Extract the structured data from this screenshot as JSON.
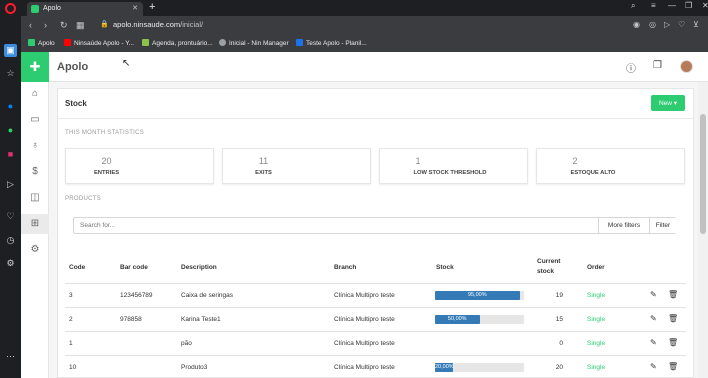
{
  "browser": {
    "tab_title": "Apolo",
    "url_host": "apolo.ninsaude.com",
    "url_path": "/inicial/",
    "bookmarks": [
      {
        "label": "Apolo",
        "color": "#2ecc71"
      },
      {
        "label": "Ninsaúde Apolo - Y...",
        "color": "#ff0000"
      },
      {
        "label": "Agenda, prontuário...",
        "color": "#8bc34a"
      },
      {
        "label": "Inicial - Nin Manager",
        "color": "#9aa0a6"
      },
      {
        "label": "Teste Apolo - Planil...",
        "color": "#1a73e8"
      }
    ]
  },
  "app": {
    "name": "Apolo",
    "brand_color": "#2ecc71"
  },
  "page": {
    "title": "Stock",
    "new_label": "New ▾",
    "stats_label": "THIS MONTH STATISTICS",
    "stats": [
      {
        "value": "20",
        "label": "ENTRIES"
      },
      {
        "value": "11",
        "label": "EXITS"
      },
      {
        "value": "1",
        "label": "LOW STOCK THRESHOLD"
      },
      {
        "value": "2",
        "label": "ESTOQUE ALTO"
      }
    ],
    "products_label": "PRODUCTS",
    "search": {
      "placeholder": "Search for...",
      "more_filters": "More filters",
      "filter": "Filter"
    },
    "columns": {
      "code": "Code",
      "barcode": "Bar code",
      "description": "Description",
      "branch": "Branch",
      "stock": "Stock",
      "current_stock_1": "Current",
      "current_stock_2": "stock",
      "order": "Order"
    },
    "rows": [
      {
        "code": "3",
        "barcode": "123456789",
        "description": "Caixa de seringas",
        "branch": "Clínica Multipro teste",
        "stock_pct": 95,
        "stock_label": "95,00%",
        "current": "19",
        "order": "Single"
      },
      {
        "code": "2",
        "barcode": "978858",
        "description": "Karina Teste1",
        "branch": "Clínica Multipro teste",
        "stock_pct": 50,
        "stock_label": "50,00%",
        "current": "15",
        "order": "Single"
      },
      {
        "code": "1",
        "barcode": "",
        "description": "pão",
        "branch": "Clínica Multipro teste",
        "stock_pct": 0,
        "stock_label": "",
        "current": "0",
        "order": "Single"
      },
      {
        "code": "10",
        "barcode": "",
        "description": "Produto3",
        "branch": "Clínica Multipro teste",
        "stock_pct": 20,
        "stock_label": "20,00%",
        "current": "20",
        "order": "Single"
      }
    ]
  }
}
